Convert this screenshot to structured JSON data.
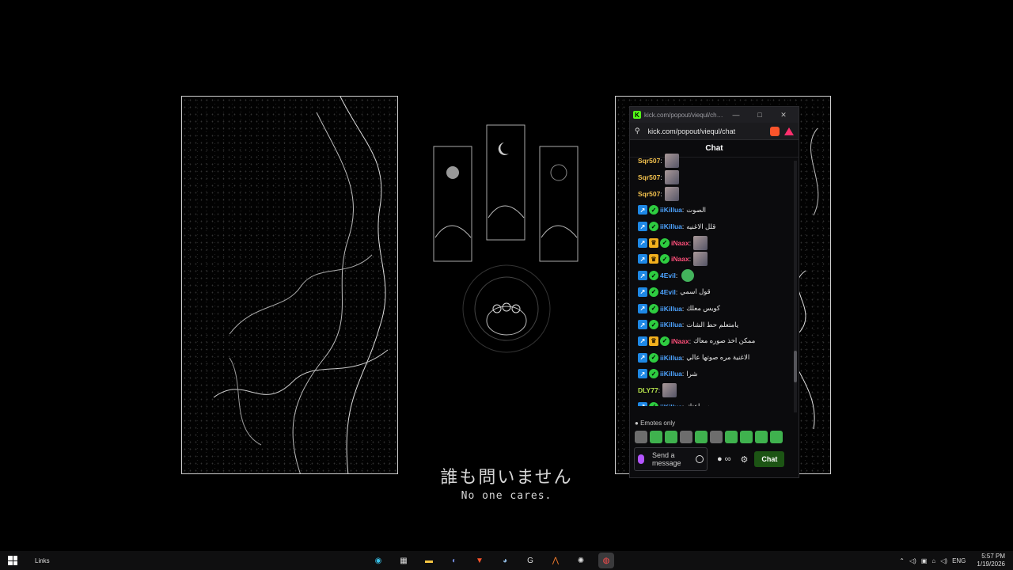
{
  "wallpaper": {
    "caption_jp": "誰も問いません",
    "caption_en": "No one cares."
  },
  "browser": {
    "title": "kick.com/popout/viequl/cha...",
    "url": "kick.com/popout/viequl/chat",
    "minimize": "—",
    "maximize": "□",
    "close": "✕"
  },
  "chat": {
    "header": "Chat",
    "messages": [
      {
        "user": "Sqr507",
        "badges": [],
        "color": "#f2c14e",
        "text": "",
        "emote": "img"
      },
      {
        "user": "Sqr507",
        "badges": [],
        "color": "#f2c14e",
        "text": "",
        "emote": "img"
      },
      {
        "user": "Sqr507",
        "badges": [],
        "color": "#f2c14e",
        "text": "",
        "emote": "img"
      },
      {
        "user": "iiKillua",
        "badges": [
          "sub",
          "verified"
        ],
        "color": "#4da3ff",
        "text": "الصوت",
        "emote": ""
      },
      {
        "user": "iiKillua",
        "badges": [
          "sub",
          "verified"
        ],
        "color": "#4da3ff",
        "text": "قلل الاغنيه",
        "emote": ""
      },
      {
        "user": "iNaax",
        "badges": [
          "sub",
          "crown",
          "verified"
        ],
        "color": "#ff4f7a",
        "text": "",
        "emote": "img"
      },
      {
        "user": "iNaax",
        "badges": [
          "sub",
          "crown",
          "verified"
        ],
        "color": "#ff4f7a",
        "text": "",
        "emote": "img"
      },
      {
        "user": "4Evil",
        "badges": [
          "sub",
          "verified"
        ],
        "color": "#4da3ff",
        "text": "",
        "emote": "green"
      },
      {
        "user": "4Evil",
        "badges": [
          "sub",
          "verified"
        ],
        "color": "#4da3ff",
        "text": "قول اسمي",
        "emote": ""
      },
      {
        "user": "iiKillua",
        "badges": [
          "sub",
          "verified"
        ],
        "color": "#4da3ff",
        "text": "كويس معلك",
        "emote": ""
      },
      {
        "user": "iiKillua",
        "badges": [
          "sub",
          "verified"
        ],
        "color": "#4da3ff",
        "text": "يامتعلم حط الشات",
        "emote": ""
      },
      {
        "user": "iNaax",
        "badges": [
          "sub",
          "crown",
          "verified"
        ],
        "color": "#ff4f7a",
        "text": "ممكن اخذ صوره معاك",
        "emote": ""
      },
      {
        "user": "iiKillua",
        "badges": [
          "sub",
          "verified"
        ],
        "color": "#4da3ff",
        "text": "الاغنية مره صوتها عالي",
        "emote": ""
      },
      {
        "user": "iiKillua",
        "badges": [
          "sub",
          "verified"
        ],
        "color": "#4da3ff",
        "text": "شرا",
        "emote": ""
      },
      {
        "user": "DLY77",
        "badges": [],
        "color": "#b7e34c",
        "text": "",
        "emote": "img"
      },
      {
        "user": "iiKillua",
        "badges": [
          "sub",
          "verified"
        ],
        "color": "#4da3ff",
        "text": "بسماعتك",
        "emote": ""
      }
    ],
    "emotes_only": "Emotes only",
    "placeholder": "Send a message",
    "chat_button": "Chat"
  },
  "taskbar": {
    "links": "Links",
    "language": "ENG",
    "time": "5:57 PM",
    "date": "1/19/2026"
  }
}
